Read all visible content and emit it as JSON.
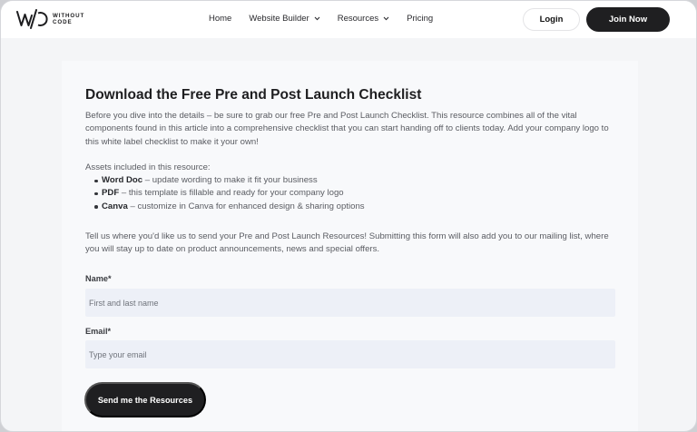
{
  "brand": {
    "logo_mark": "W/O",
    "logo_text_line1": "WITHOUT",
    "logo_text_line2": "CODE"
  },
  "nav": {
    "links": [
      {
        "label": "Home",
        "has_dropdown": false
      },
      {
        "label": "Website Builder",
        "has_dropdown": true
      },
      {
        "label": "Resources",
        "has_dropdown": true
      },
      {
        "label": "Pricing",
        "has_dropdown": false
      }
    ],
    "login_label": "Login",
    "join_label": "Join Now"
  },
  "checklist": {
    "title": "Download the Free Pre and Post Launch Checklist",
    "intro": "Before you dive into the details – be sure to grab our free Pre and Post Launch Checklist. This resource combines all of the vital components found in this article into a comprehensive checklist that you can start handing off to clients today. Add your company logo to this white label checklist to make it your own!",
    "assets_heading": "Assets included in this resource:",
    "assets": [
      {
        "name": "Word Doc",
        "desc": " – update wording to make it fit your business"
      },
      {
        "name": "PDF",
        "desc": " – this template is fillable and ready for your company logo"
      },
      {
        "name": "Canva",
        "desc": " – customize in Canva for enhanced design & sharing options"
      }
    ],
    "form_intro": "Tell us where you'd like us to send your Pre and Post Launch Resources! Submitting this form will also add you to our mailing list, where you will stay up to date on product announcements, news and special offers."
  },
  "form": {
    "name_label": "Name*",
    "name_placeholder": "First and last name",
    "name_value": "",
    "email_label": "Email*",
    "email_placeholder": "Type your email",
    "email_value": "",
    "submit_label": "Send me the Resources"
  },
  "colors": {
    "primary_button": "#1f1f21",
    "page_background": "#f4f5f7",
    "input_background": "#edf0f7",
    "body_text": "#5a5c62"
  },
  "icons": {
    "dropdown": "chevron-down-icon"
  }
}
